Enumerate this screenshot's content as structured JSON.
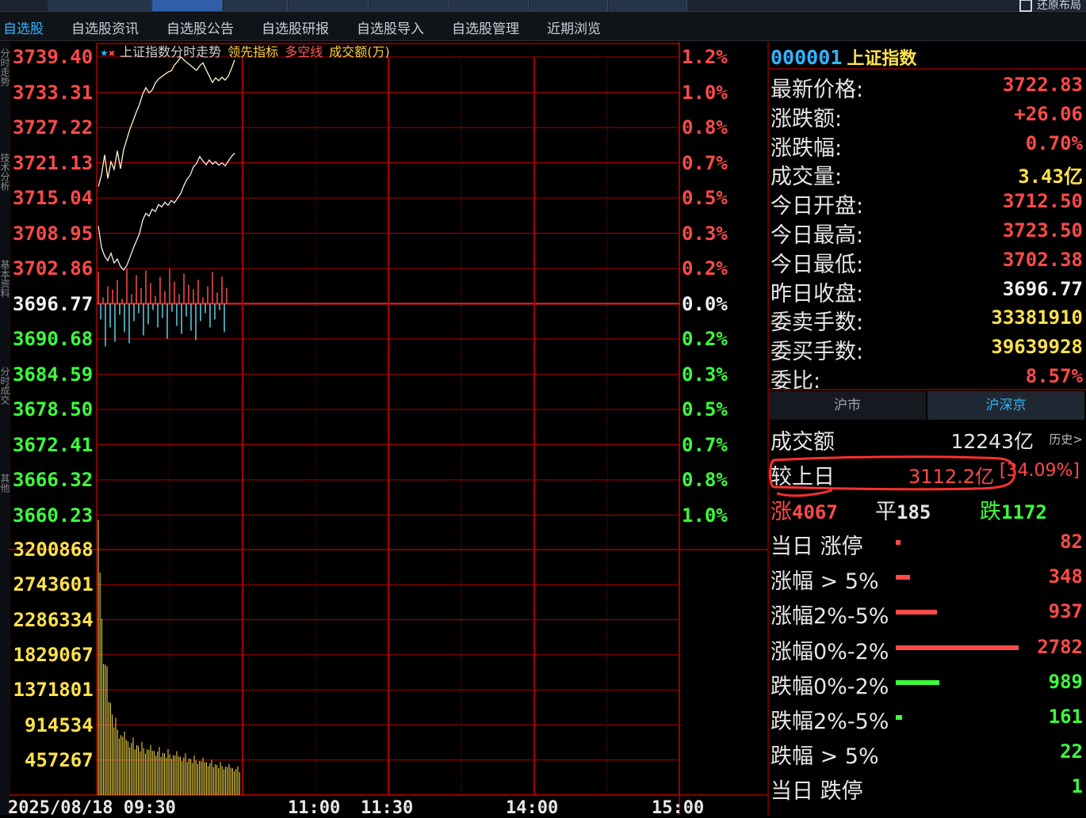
{
  "toolbar": {
    "restore_label": "还原布局"
  },
  "subnav": {
    "items": [
      "自选股",
      "自选股资讯",
      "自选股公告",
      "自选股研报",
      "自选股导入",
      "自选股管理",
      "近期浏览"
    ],
    "active_index": 0
  },
  "sidetabs": [
    "分时走势",
    "技术分析",
    "基本资料",
    "分时成交",
    "其他"
  ],
  "chart": {
    "legend": {
      "title": "上证指数分时走势",
      "indicator1": "领先指标",
      "indicator2": "多空线",
      "indicator3": "成交额(万)"
    },
    "price_labels": [
      "3739.40",
      "3733.31",
      "3727.22",
      "3721.13",
      "3715.04",
      "3708.95",
      "3702.86",
      "3696.77",
      "3690.68",
      "3684.59",
      "3678.50",
      "3672.41",
      "3666.32",
      "3660.23"
    ],
    "pct_labels": [
      "1.2%",
      "1.0%",
      "0.8%",
      "0.7%",
      "0.5%",
      "0.3%",
      "0.2%",
      "0.0%",
      "0.2%",
      "0.3%",
      "0.5%",
      "0.7%",
      "0.8%",
      "1.0%"
    ],
    "volume_labels": [
      "3200868",
      "2743601",
      "2286334",
      "1829067",
      "1371801",
      "914534",
      "457267"
    ],
    "time_labels": [
      "2025/08/18 09:30",
      "11:00",
      "11:30",
      "14:00",
      "15:00"
    ],
    "colors": {
      "up": "#ff4a4a",
      "down": "#3cff3c",
      "flat": "#f0f0f0",
      "grid": "#b00000",
      "price_line": "#f0f0f0",
      "avg_line": "#ffe24a",
      "volume": "#ffe24a",
      "cyan_bar": "#5ad2e6"
    }
  },
  "chart_data": {
    "type": "line",
    "title": "上证指数分时走势",
    "prev_close": 3696.77,
    "ylim": [
      3660.23,
      3739.4
    ],
    "x_range": [
      "09:30",
      "15:00"
    ],
    "series": [
      {
        "name": "",
        "values": [
          3710.2,
          3706.5,
          3705.0,
          3704.2,
          3705.5,
          3703.8,
          3704.5,
          3703.2,
          3702.6,
          3703.4,
          3704.8,
          3706.3,
          3707.6,
          3708.9,
          3711.2,
          3712.4,
          3711.9,
          3713.1,
          3712.7,
          3713.9,
          3713.5,
          3714.3,
          3713.8,
          3714.6,
          3714.2,
          3715.0,
          3715.8,
          3717.2,
          3718.3,
          3719.0,
          3720.4,
          3721.0,
          3722.2,
          3721.4,
          3720.8,
          3721.6,
          3720.9,
          3721.3,
          3720.7,
          3721.1,
          3720.6,
          3721.4,
          3722.2,
          3722.8
        ]
      },
      {
        "name": "",
        "values": [
          3717.0,
          3719.0,
          3722.5,
          3718.4,
          3721.3,
          3720.0,
          3723.2,
          3720.1,
          3723.4,
          3725.2,
          3727.0,
          3728.4,
          3729.9,
          3731.2,
          3733.0,
          3734.1,
          3733.2,
          3733.7,
          3734.9,
          3735.6,
          3736.0,
          3736.4,
          3736.8,
          3737.0,
          3738.0,
          3738.6,
          3739.4,
          3738.9,
          3738.4,
          3738.0,
          3737.5,
          3737.1,
          3737.9,
          3738.4,
          3737.2,
          3736.1,
          3735.0,
          3735.8,
          3735.3,
          3735.9,
          3735.4,
          3736.1,
          3737.4,
          3738.9
        ]
      }
    ]
  },
  "panel": {
    "code": "000001",
    "name": "上证指数",
    "rows": [
      {
        "k": "最新价格:",
        "v": "3722.83",
        "c": "red"
      },
      {
        "k": "涨跌额:",
        "v": "+26.06",
        "c": "red"
      },
      {
        "k": "涨跌幅:",
        "v": "0.70%",
        "c": "red"
      },
      {
        "k": "成交量:",
        "v": "3.43亿",
        "c": "yellow"
      },
      {
        "k": "今日开盘:",
        "v": "3712.50",
        "c": "red"
      },
      {
        "k": "今日最高:",
        "v": "3723.50",
        "c": "red"
      },
      {
        "k": "今日最低:",
        "v": "3702.38",
        "c": "red"
      },
      {
        "k": "昨日收盘:",
        "v": "3696.77",
        "c": "white"
      },
      {
        "k": "委卖手数:",
        "v": "33381910",
        "c": "yellow"
      },
      {
        "k": "委买手数:",
        "v": "39639928",
        "c": "yellow"
      },
      {
        "k": "委比:",
        "v": "8.57%",
        "c": "red"
      }
    ],
    "market_tabs": [
      "沪市",
      "沪深京"
    ],
    "turnover": {
      "label": "成交额",
      "value": "12243亿",
      "history": "历史>"
    },
    "vs_prev": {
      "label": "较上日",
      "value": "3112.2亿",
      "pct": "34.09%"
    },
    "breadth": {
      "up_label": "涨",
      "up": "4067",
      "flat_label": "平",
      "flat": "185",
      "down_label": "跌",
      "down": "1172"
    },
    "dist": [
      {
        "k": "当日 涨停",
        "v": "82",
        "c": "red",
        "bar": 6
      },
      {
        "k": "涨幅 > 5%",
        "v": "348",
        "c": "red",
        "bar": 18
      },
      {
        "k": "涨幅2%-5%",
        "v": "937",
        "c": "red",
        "bar": 52
      },
      {
        "k": "涨幅0%-2%",
        "v": "2782",
        "c": "red",
        "bar": 155
      },
      {
        "k": "跌幅0%-2%",
        "v": "989",
        "c": "green",
        "bar": 55
      },
      {
        "k": "跌幅2%-5%",
        "v": "161",
        "c": "green",
        "bar": 8
      },
      {
        "k": "跌幅 > 5%",
        "v": "22",
        "c": "green",
        "bar": 0
      },
      {
        "k": "当日 跌停",
        "v": "1",
        "c": "green",
        "bar": 0
      }
    ]
  }
}
